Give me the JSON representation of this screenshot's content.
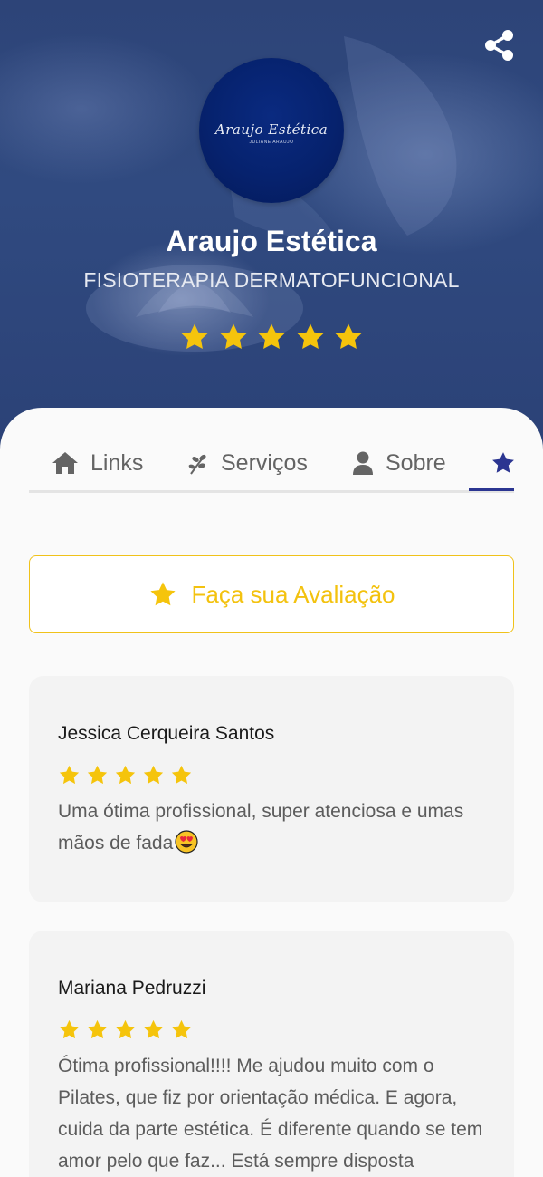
{
  "profile": {
    "name": "Araujo Estética",
    "subtitle": "FISIOTERAPIA DERMATOFUNCIONAL",
    "logo_text": "Araujo Estética",
    "logo_subtext": "JULIANE ARAUJO",
    "rating": 5
  },
  "icons": {
    "share": "share-icon",
    "links": "home-icon",
    "services": "leaf-icon",
    "about": "user-icon",
    "reviews": "star-icon"
  },
  "tabs": {
    "links": "Links",
    "services": "Serviços",
    "about": "Sobre",
    "active": "reviews"
  },
  "review_button": {
    "label": "Faça sua Avaliação"
  },
  "reviews": [
    {
      "author": "Jessica Cerqueira Santos",
      "rating": 5,
      "text": "Uma ótima profissional, super atenciosa e umas mãos de fada",
      "emoji": "😍"
    },
    {
      "author": "Mariana Pedruzzi",
      "rating": 5,
      "text": "Ótima profissional!!!! Me ajudou muito com o Pilates, que fiz por orientação médica. E agora, cuida da parte estética. É diferente quando se tem amor pelo que faz... Está sempre disposta"
    }
  ],
  "colors": {
    "primary": "#2b3591",
    "star": "#f5c40c",
    "hero_bg": "#2f477e",
    "text_muted": "#646464"
  }
}
